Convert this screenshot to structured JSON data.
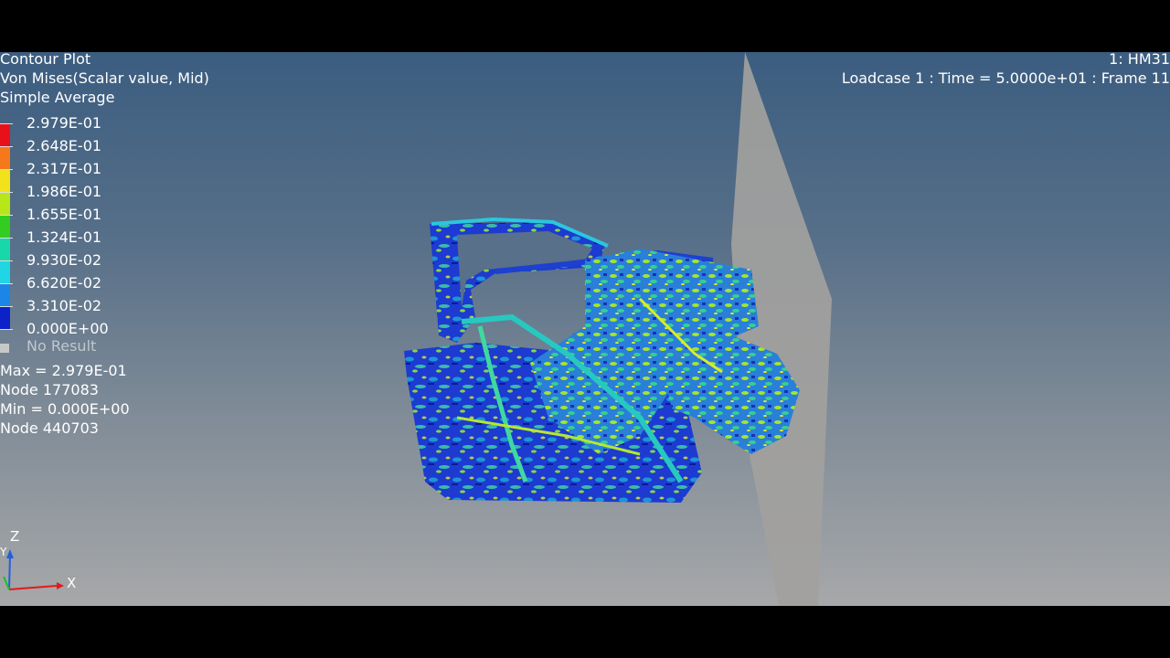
{
  "contour": {
    "title": "Contour Plot",
    "result_type": "Von Mises(Scalar value, Mid)",
    "averaging": "Simple Average"
  },
  "legend": {
    "levels": [
      {
        "label": "2.979E-01",
        "color": "#e8111a"
      },
      {
        "label": "2.648E-01",
        "color": "#f5781b"
      },
      {
        "label": "2.317E-01",
        "color": "#f2e21b"
      },
      {
        "label": "1.986E-01",
        "color": "#b7e619"
      },
      {
        "label": "1.655E-01",
        "color": "#32cd20"
      },
      {
        "label": "1.324E-01",
        "color": "#18d8a9"
      },
      {
        "label": "9.930E-02",
        "color": "#20d5e4"
      },
      {
        "label": "6.620E-02",
        "color": "#1b86e8"
      },
      {
        "label": "3.310E-02",
        "color": "#0c22c8"
      },
      {
        "label": "0.000E+00",
        "color": ""
      }
    ],
    "no_result_label": "No Result"
  },
  "extremes": {
    "max_line": "Max =  2.979E-01",
    "max_node": "Node 177083",
    "min_line": "Min =  0.000E+00",
    "min_node": "Node 440703"
  },
  "header_right": {
    "model": "1: HM31",
    "loadcase": "Loadcase 1 : Time = 5.0000e+01 : Frame 11"
  },
  "triad": {
    "z_label": "Z",
    "x_label": "X",
    "y_label": "Y"
  }
}
